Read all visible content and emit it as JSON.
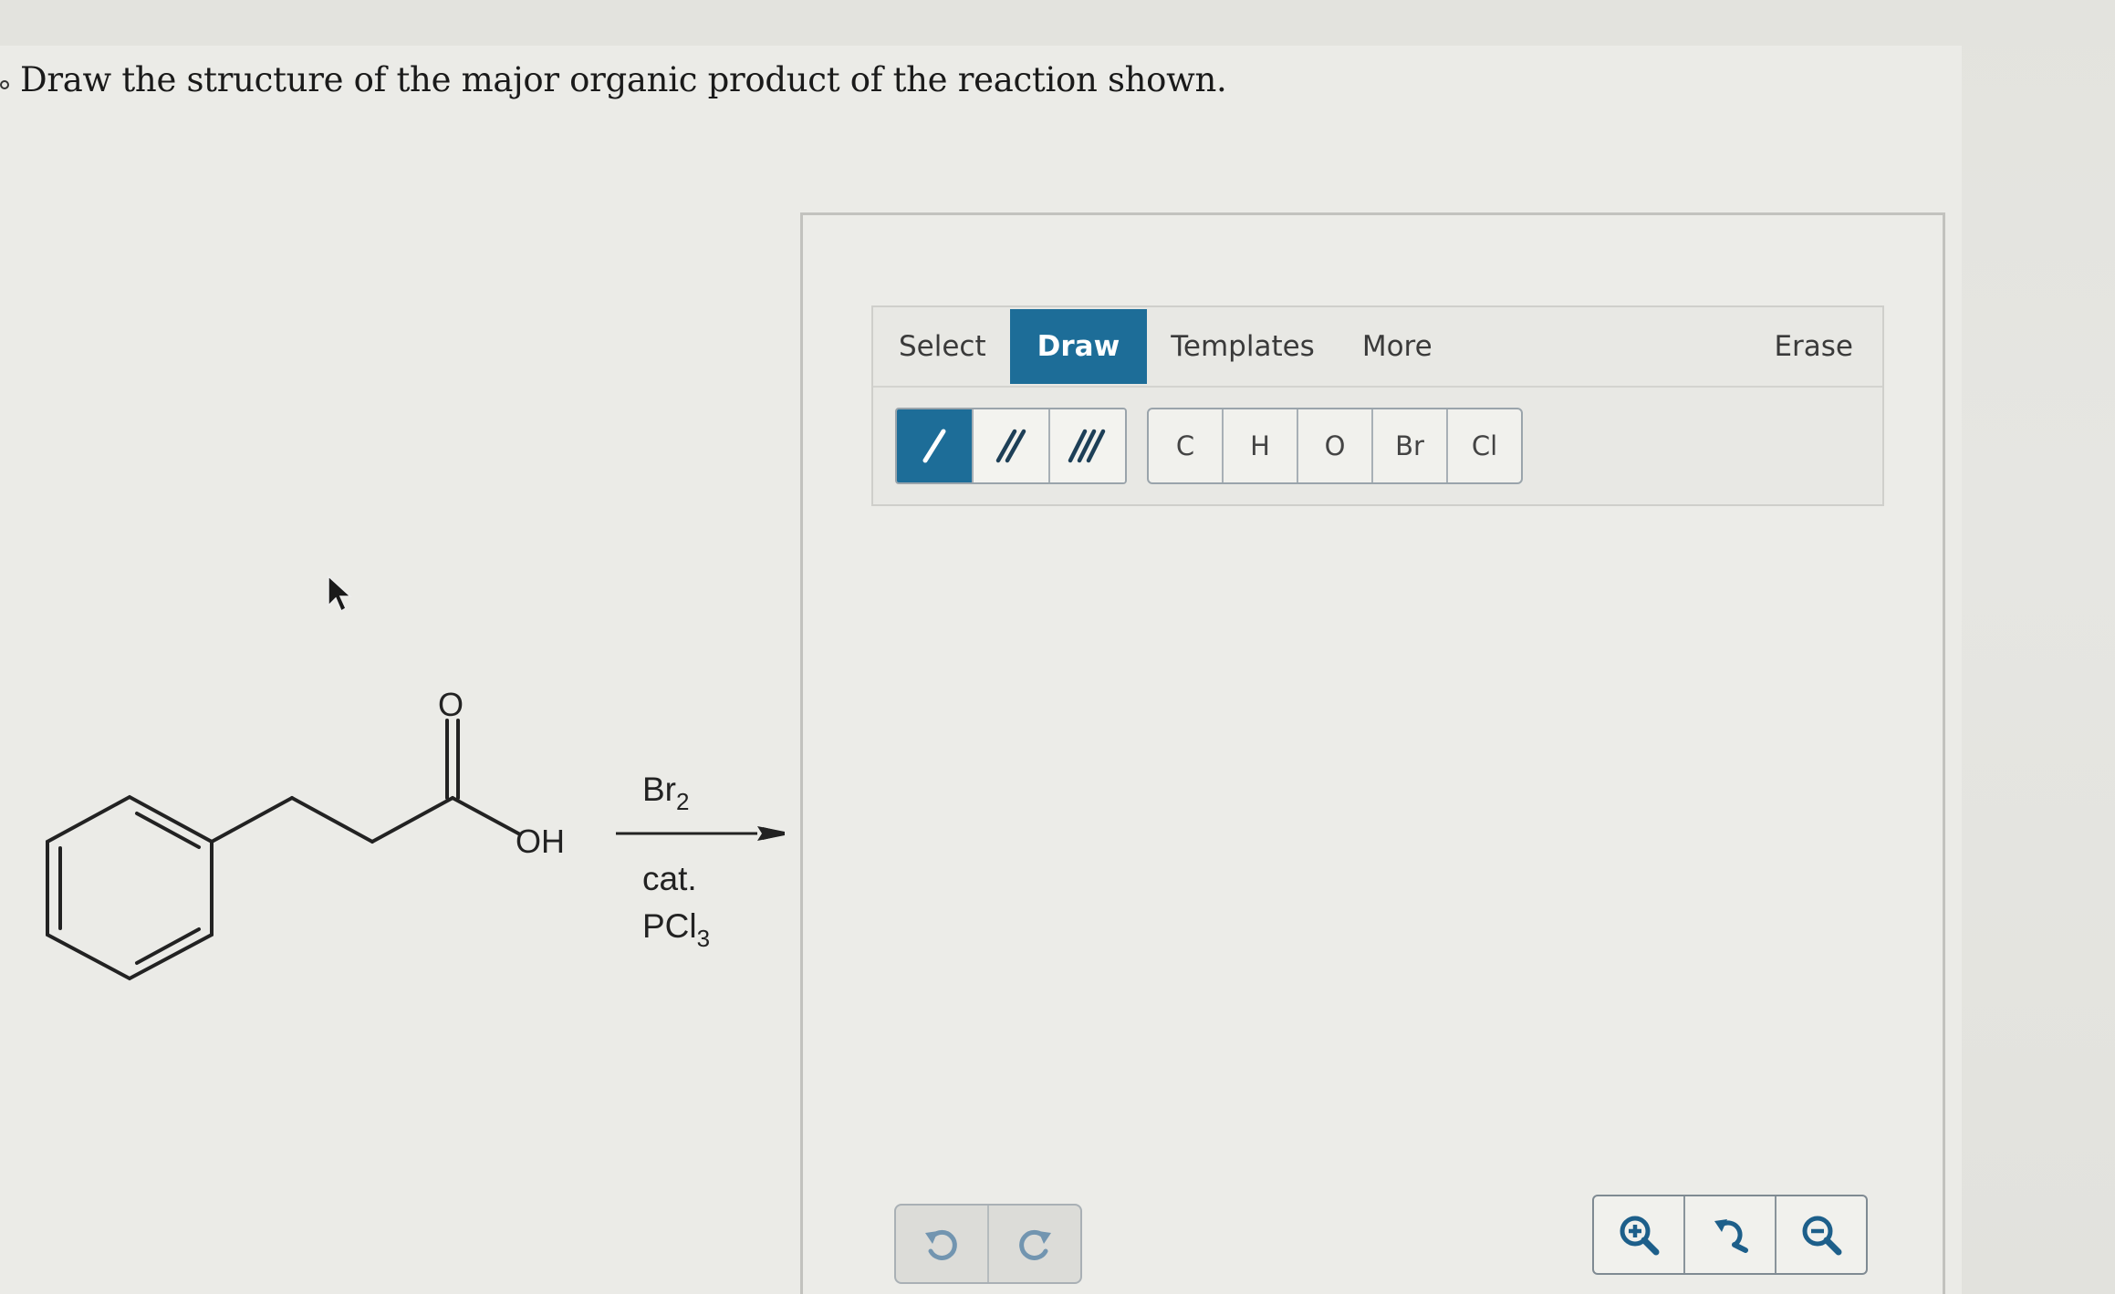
{
  "question": {
    "text": "Draw the structure of the major organic product of the reaction shown."
  },
  "reaction": {
    "reactant_labels": {
      "carbonyl_oxygen": "O",
      "hydroxyl": "OH"
    },
    "reagents_above": {
      "element": "Br",
      "subscript": "2"
    },
    "reagents_below": {
      "line1": "cat.",
      "line2_element": "PCl",
      "line2_subscript": "3"
    }
  },
  "editor": {
    "tabs": [
      {
        "label": "Select",
        "active": false
      },
      {
        "label": "Draw",
        "active": true
      },
      {
        "label": "Templates",
        "active": false
      },
      {
        "label": "More",
        "active": false
      }
    ],
    "erase_label": "Erase",
    "bond_tools": [
      {
        "icon": "single-bond-icon",
        "active": true
      },
      {
        "icon": "double-bond-icon",
        "active": false
      },
      {
        "icon": "triple-bond-icon",
        "active": false
      }
    ],
    "atoms": [
      "C",
      "H",
      "O",
      "Br",
      "Cl"
    ],
    "history": [
      "undo-icon",
      "redo-icon"
    ],
    "zoom": [
      "zoom-in-icon",
      "zoom-reset-icon",
      "zoom-out-icon"
    ]
  },
  "colors": {
    "accent": "#1d6d98",
    "background": "#e6e6e2",
    "editor_border": "#c2c2be"
  }
}
